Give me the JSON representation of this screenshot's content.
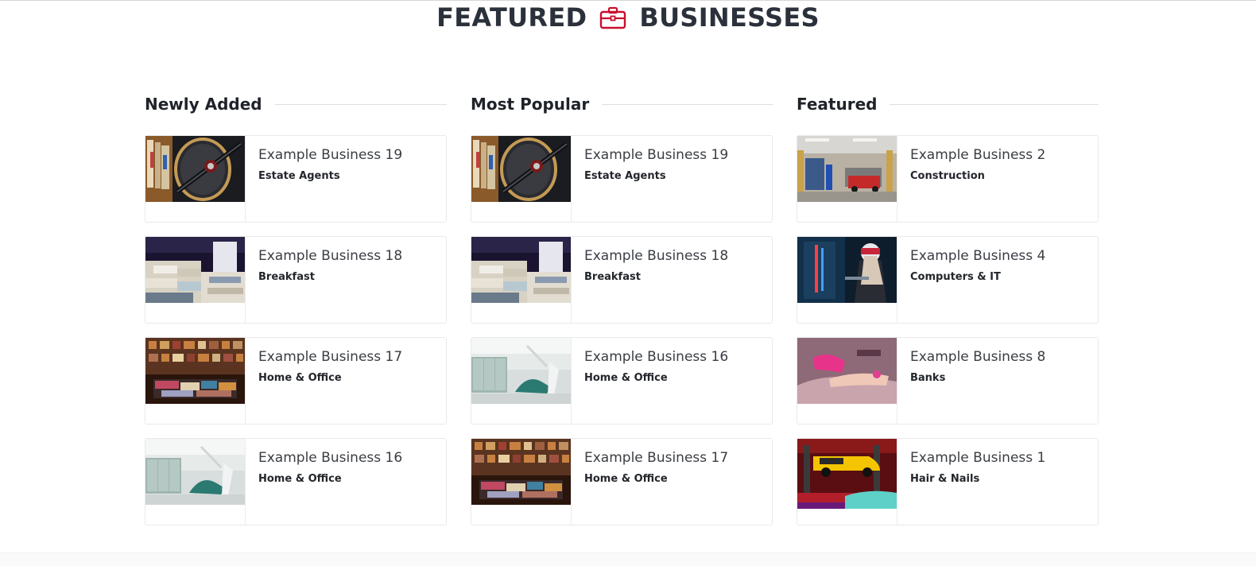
{
  "header": {
    "title_left": "FEATURED",
    "title_right": "BUSINESSES",
    "icon": "briefcase-icon",
    "accent_color": "#c8102e"
  },
  "columns": [
    {
      "title": "Newly Added",
      "items": [
        {
          "name": "Example Business 19",
          "category": "Estate Agents",
          "image": "fishing-gear"
        },
        {
          "name": "Example Business 18",
          "category": "Breakfast",
          "image": "bookstore-stacks"
        },
        {
          "name": "Example Business 17",
          "category": "Home & Office",
          "image": "library-shelves"
        },
        {
          "name": "Example Business 16",
          "category": "Home & Office",
          "image": "dental-clinic"
        }
      ]
    },
    {
      "title": "Most Popular",
      "items": [
        {
          "name": "Example Business 19",
          "category": "Estate Agents",
          "image": "fishing-gear"
        },
        {
          "name": "Example Business 18",
          "category": "Breakfast",
          "image": "bookstore-stacks"
        },
        {
          "name": "Example Business 16",
          "category": "Home & Office",
          "image": "dental-clinic"
        },
        {
          "name": "Example Business 17",
          "category": "Home & Office",
          "image": "library-shelves"
        }
      ]
    },
    {
      "title": "Featured",
      "items": [
        {
          "name": "Example Business 2",
          "category": "Construction",
          "image": "garage-workshop"
        },
        {
          "name": "Example Business 4",
          "category": "Computers & IT",
          "image": "pc-technician"
        },
        {
          "name": "Example Business 8",
          "category": "Banks",
          "image": "nail-salon"
        },
        {
          "name": "Example Business 1",
          "category": "Hair & Nails",
          "image": "car-lift"
        }
      ]
    }
  ]
}
